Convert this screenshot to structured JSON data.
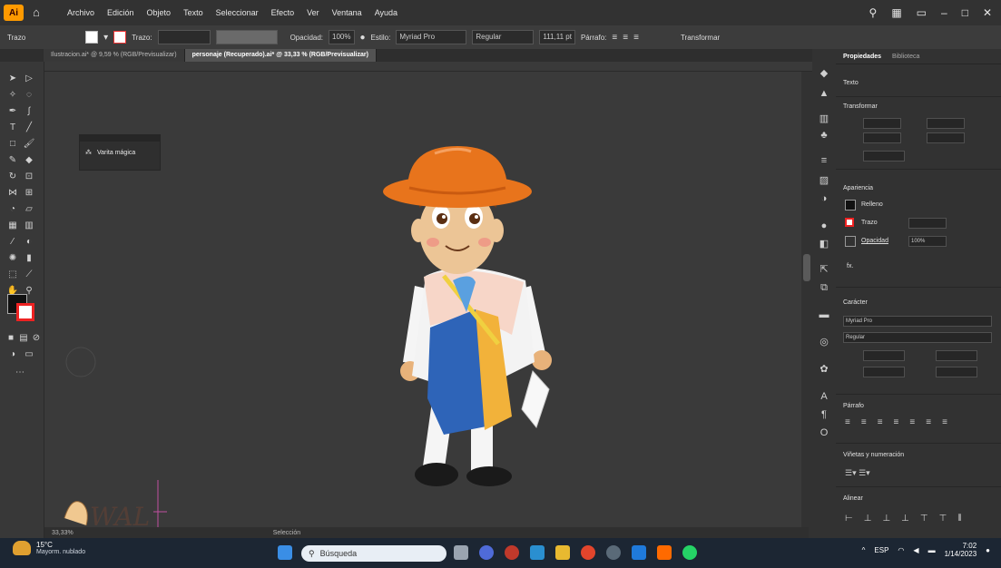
{
  "menu": {
    "app_logo": "Ai",
    "items": [
      "Archivo",
      "Edición",
      "Objeto",
      "Texto",
      "Seleccionar",
      "Efecto",
      "Ver",
      "Ventana",
      "Ayuda"
    ]
  },
  "controlbar": {
    "left_label": "Trazo",
    "stroke_label": "Trazo:",
    "opacity_label": "Opacidad:",
    "opacity_value": "100%",
    "style_label": "Estilo:",
    "font_value": "Myriad Pro",
    "font_style": "Regular",
    "font_size": "111,11 pt",
    "paragraph_label": "Párrafo:",
    "transform_label": "Transformar"
  },
  "tabs": [
    {
      "label": "Ilustracion.ai* @ 9,59 % (RGB/Previsualizar)",
      "active": false
    },
    {
      "label": "personaje (Recuperado).ai* @ 33,33 % (RGB/Previsualizar)",
      "active": true
    }
  ],
  "float_panel": {
    "item": "Varita mágica"
  },
  "properties": {
    "tabs": [
      "Propiedades",
      "Biblioteca"
    ],
    "sections": [
      "Texto",
      "Transformar",
      "Apariencia",
      "Carácter",
      "Párrafo",
      "Viñetas y numeración",
      "Alinear"
    ],
    "fill_label": "Relleno",
    "stroke_label": "Trazo",
    "opacity_label": "Opacidad",
    "opacity_value": "100%",
    "font": "Myriad Pro",
    "font_style": "Regular"
  },
  "status": {
    "zoom": "33,33%",
    "tool": "Selección"
  },
  "taskbar": {
    "weather_temp": "15°C",
    "weather_desc": "Mayorm. nublado",
    "search_placeholder": "Búsqueda",
    "lang": "ESP",
    "time": "7:02",
    "date": "1/14/2023"
  },
  "colors": {
    "accent": "#ff9a00",
    "canvas": "#3a3a3a",
    "panel": "#323232"
  }
}
